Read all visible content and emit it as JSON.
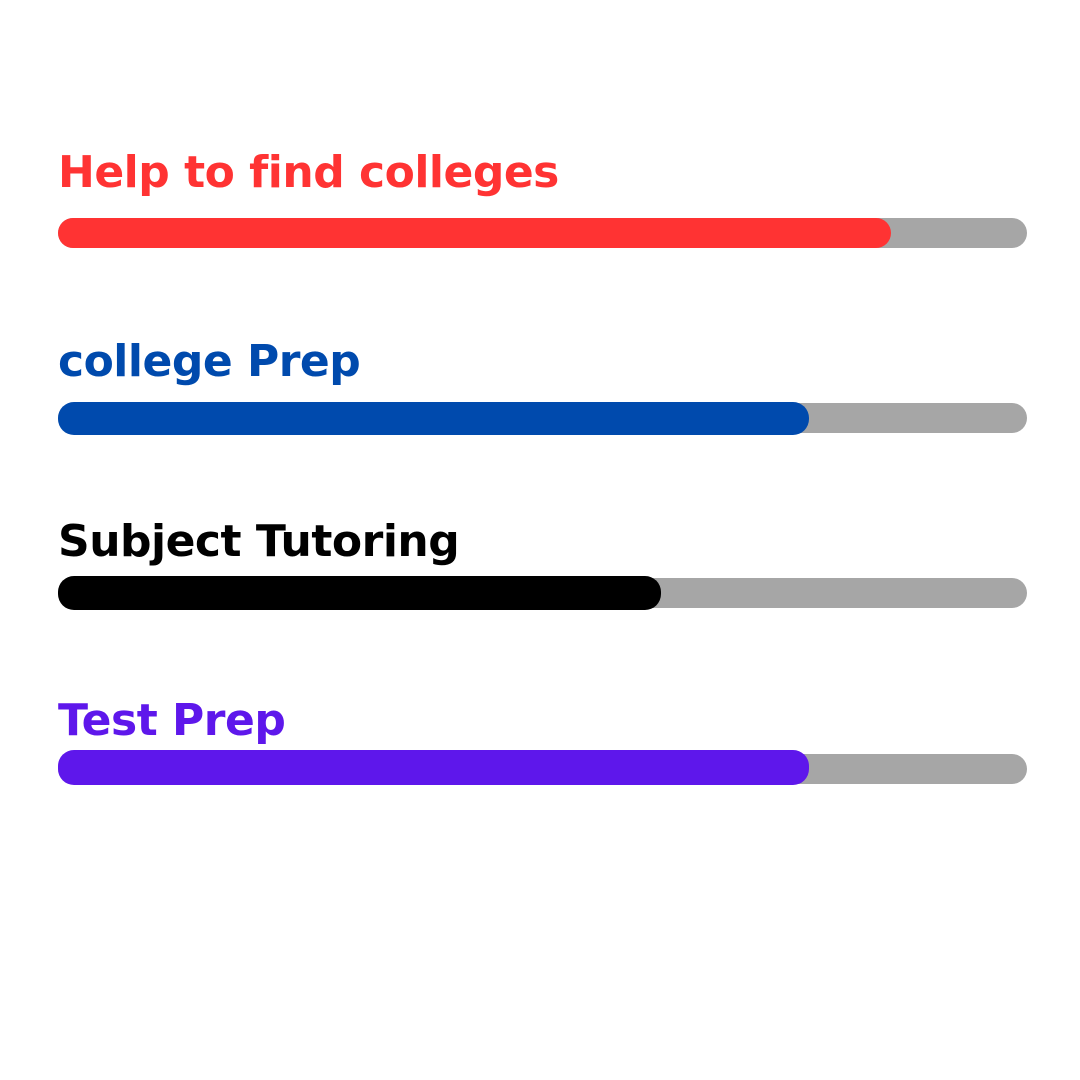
{
  "skills": [
    {
      "label": "Help to find colleges",
      "color": "#ff3333",
      "progress": 0.86
    },
    {
      "label": "college Prep",
      "color": "#004aad",
      "progress": 0.775
    },
    {
      "label": "Subject Tutoring",
      "color": "#000000",
      "progress": 0.622
    },
    {
      "label": "Test Prep",
      "color": "#5e17eb",
      "progress": 0.775
    }
  ],
  "track_color": "#a6a6a6"
}
